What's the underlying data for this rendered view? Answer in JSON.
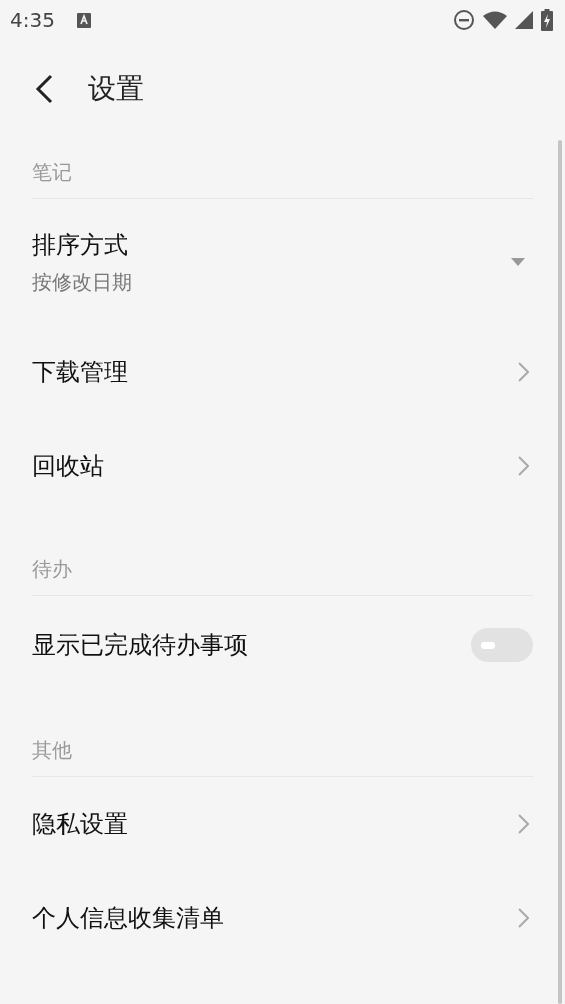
{
  "status_bar": {
    "time": "4:35"
  },
  "header": {
    "title": "设置"
  },
  "sections": [
    {
      "title": "笔记",
      "items": [
        {
          "kind": "dropdown",
          "title": "排序方式",
          "value": "按修改日期"
        },
        {
          "kind": "link",
          "title": "下载管理"
        },
        {
          "kind": "link",
          "title": "回收站"
        }
      ]
    },
    {
      "title": "待办",
      "items": [
        {
          "kind": "toggle",
          "title": "显示已完成待办事项",
          "on": false
        }
      ]
    },
    {
      "title": "其他",
      "items": [
        {
          "kind": "link",
          "title": "隐私设置"
        },
        {
          "kind": "link",
          "title": "个人信息收集清单"
        }
      ]
    }
  ]
}
